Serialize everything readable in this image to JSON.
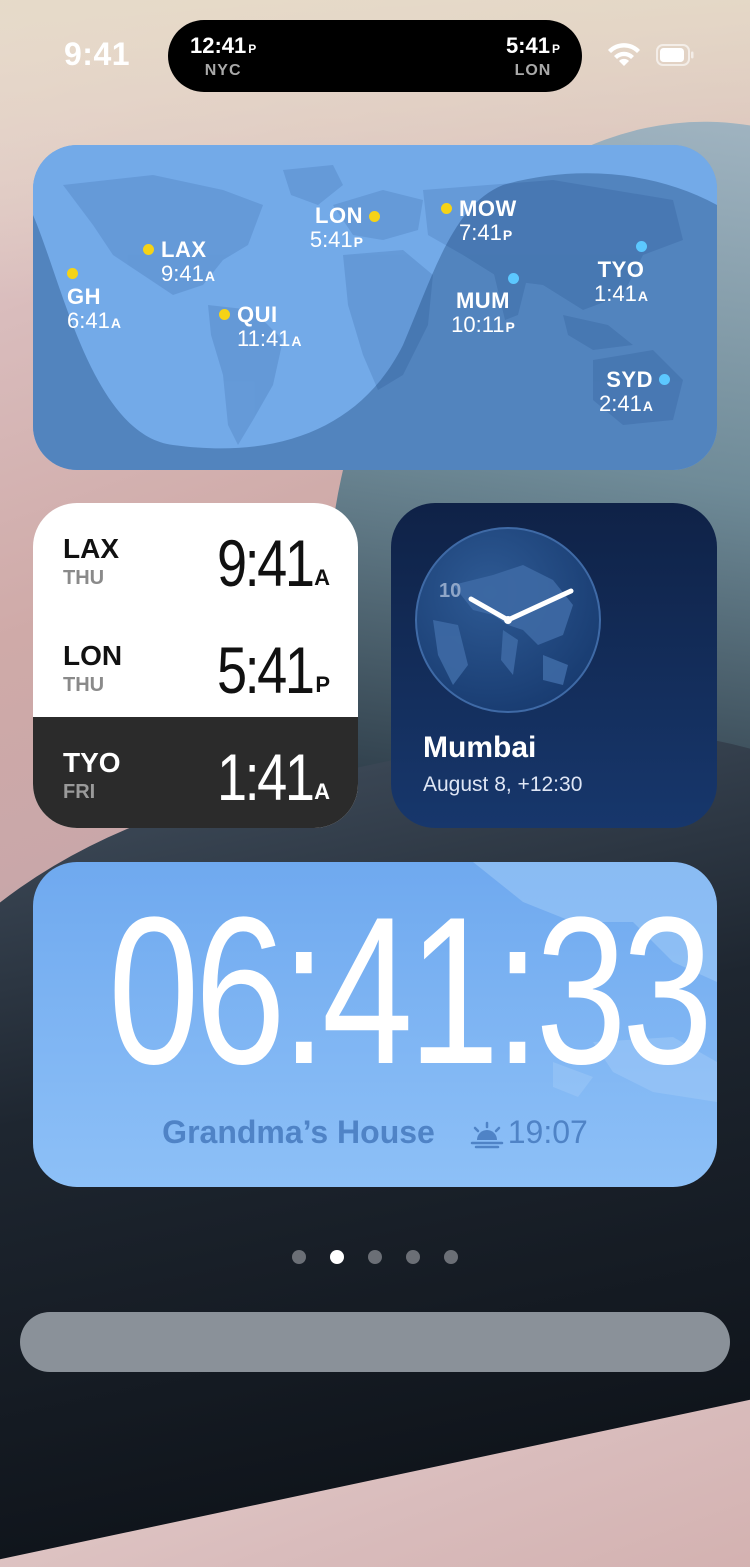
{
  "status_bar": {
    "time": "9:41"
  },
  "dynamic_island": {
    "left": {
      "time": "12:41",
      "ampm": "P",
      "city": "NYC"
    },
    "right": {
      "time": "5:41",
      "ampm": "P",
      "city": "LON"
    }
  },
  "world_map": {
    "cities": [
      {
        "code": "GH",
        "time": "6:41",
        "ampm": "A"
      },
      {
        "code": "LAX",
        "time": "9:41",
        "ampm": "A"
      },
      {
        "code": "QUI",
        "time": "11:41",
        "ampm": "A"
      },
      {
        "code": "LON",
        "time": "5:41",
        "ampm": "P"
      },
      {
        "code": "MOW",
        "time": "7:41",
        "ampm": "P"
      },
      {
        "code": "MUM",
        "time": "10:11",
        "ampm": "P"
      },
      {
        "code": "TYO",
        "time": "1:41",
        "ampm": "A"
      },
      {
        "code": "SYD",
        "time": "2:41",
        "ampm": "A"
      }
    ]
  },
  "city_list": [
    {
      "code": "LAX",
      "day": "THU",
      "time": "9:41",
      "ampm": "A"
    },
    {
      "code": "LON",
      "day": "THU",
      "time": "5:41",
      "ampm": "P"
    },
    {
      "code": "TYO",
      "day": "FRI",
      "time": "1:41",
      "ampm": "A"
    }
  ],
  "analog_clock": {
    "hour_label": "10",
    "city": "Mumbai",
    "subtitle": "August 8, +12:30"
  },
  "digital_clock": {
    "time": "06:41:33",
    "location": "Grandma’s House",
    "sunrise_time": "19:07"
  },
  "page_indicator": {
    "count": 5,
    "active_index": 1
  }
}
